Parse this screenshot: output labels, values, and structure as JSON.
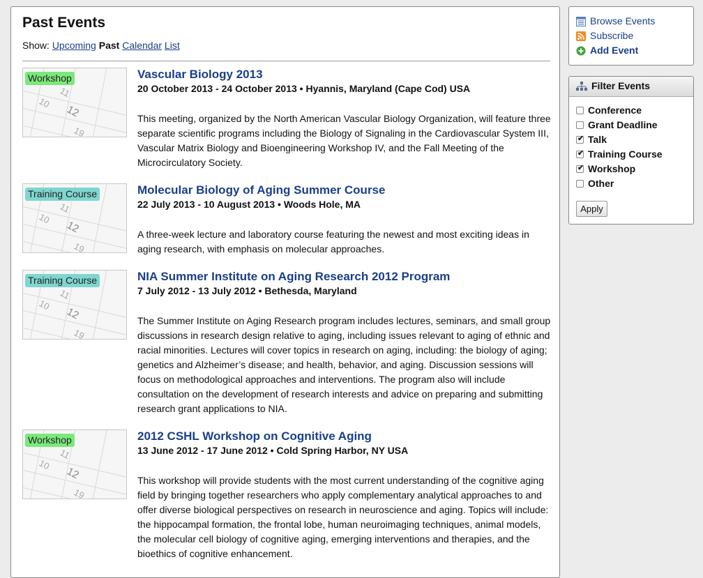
{
  "main": {
    "title": "Past Events",
    "show_label": "Show:",
    "show_links": {
      "upcoming": "Upcoming",
      "past": "Past",
      "calendar": "Calendar",
      "list": "List"
    }
  },
  "events": [
    {
      "tag": "Workshop",
      "title": "Vascular Biology 2013",
      "meta": "20 October 2013 - 24 October 2013 • Hyannis, Maryland (Cape Cod) USA",
      "description": "This meeting, organized by the North American Vascular Biology Organization, will feature three separate scientific programs including the Biology of Signaling in the Cardiovascular System III, Vascular Matrix Biology and Bioengineering Workshop IV, and the Fall Meeting of the Microcirculatory Society."
    },
    {
      "tag": "Training Course",
      "title": "Molecular Biology of Aging Summer Course",
      "meta": "22 July 2013 - 10 August 2013 • Woods Hole, MA",
      "description": "A three-week lecture and laboratory course featuring the newest and most exciting ideas in aging research, with emphasis on molecular approaches."
    },
    {
      "tag": "Training Course",
      "title": "NIA Summer Institute on Aging Research 2012 Program",
      "meta": "7 July 2012 - 13 July 2012 • Bethesda, Maryland",
      "description": "The Summer Institute on Aging Research program includes lectures, seminars, and small group discussions in research design relative to aging, including issues relevant to aging of ethnic and racial minorities. Lectures will cover topics in research on aging, including: the biology of aging; genetics and Alzheimer’s disease; and health, behavior, and aging. Discussion sessions will focus on methodological approaches and interventions. The program also will include consultation on the development of research interests and advice on preparing and submitting research grant applications to NIA."
    },
    {
      "tag": "Workshop",
      "title": "2012 CSHL Workshop on Cognitive Aging",
      "meta": "13 June 2012 - 17 June 2012 • Cold Spring Harbor, NY USA",
      "description": "This workshop will provide students with the most current understanding of the cognitive aging field by bringing together researchers who apply complementary analytical approaches to and offer diverse biological perspectives on research in neuroscience and aging. Topics will include: the hippocampal formation, the frontal lobe, human neuroimaging techniques, animal models, the molecular cell biology of cognitive aging, emerging interventions and therapies, and the bioethics of cognitive enhancement."
    }
  ],
  "thumb_numbers": [
    "10",
    "11",
    "12",
    "19"
  ],
  "sidebar": {
    "links": [
      {
        "label": "Browse Events",
        "icon": "calendar-list-icon"
      },
      {
        "label": "Subscribe",
        "icon": "rss-icon"
      },
      {
        "label": "Add Event",
        "icon": "add-circle-icon"
      }
    ],
    "filter": {
      "heading": "Filter Events",
      "icon": "hierarchy-icon",
      "options": [
        {
          "label": "Conference",
          "checked": false
        },
        {
          "label": "Grant Deadline",
          "checked": false
        },
        {
          "label": "Talk",
          "checked": true
        },
        {
          "label": "Training Course",
          "checked": true
        },
        {
          "label": "Workshop",
          "checked": true
        },
        {
          "label": "Other",
          "checked": false
        }
      ],
      "apply_label": "Apply"
    }
  },
  "colors": {
    "link": "#1a3e8c",
    "workshop_tag": "#7be87b",
    "training_tag": "#7fd6d0",
    "rss": "#f08c24",
    "add": "#3aa63a"
  }
}
